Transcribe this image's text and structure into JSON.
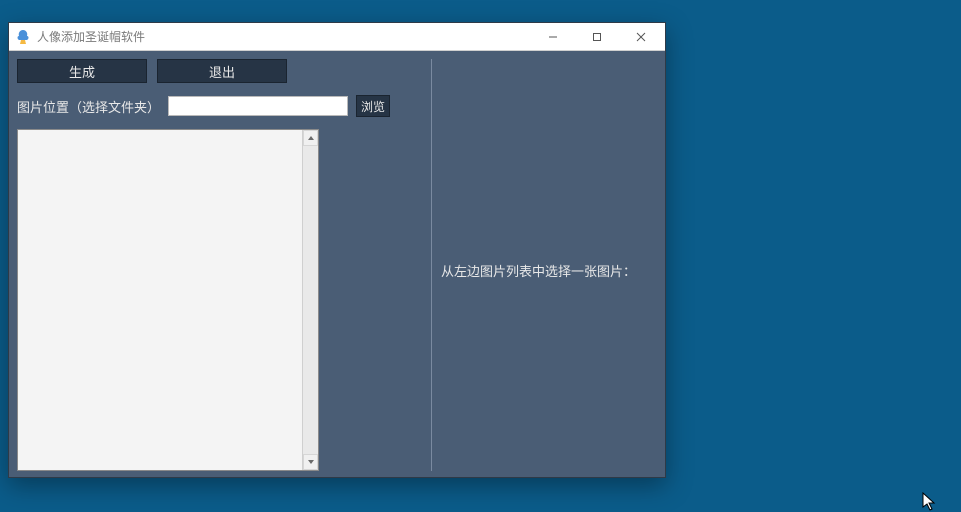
{
  "window": {
    "title": "人像添加圣诞帽软件"
  },
  "toolbar": {
    "generate_label": "生成",
    "exit_label": "退出"
  },
  "path": {
    "label": "图片位置（选择文件夹）",
    "value": "",
    "browse_label": "浏览"
  },
  "right_panel": {
    "hint": "从左边图片列表中选择一张图片："
  }
}
